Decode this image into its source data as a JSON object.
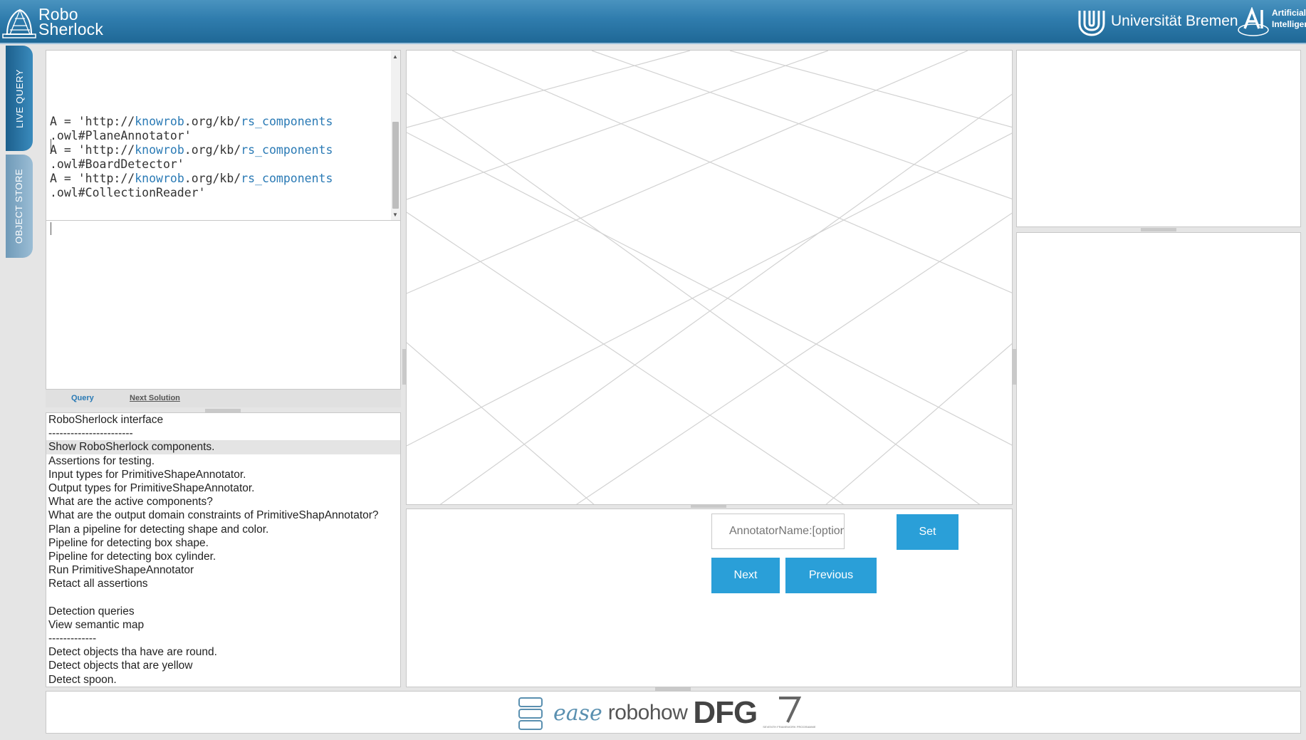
{
  "header": {
    "logo_line1": "Robo",
    "logo_line2": "Sherlock",
    "university": "Universität Bremen",
    "ai_line1": "Artificial",
    "ai_line2": "Intelligen"
  },
  "side_tabs": {
    "live_query": "LIVE QUERY",
    "object_store": "OBJECT STORE"
  },
  "editor": {
    "lines": [
      {
        "prefix": "A = 'http://",
        "host": "knowrob",
        "mid": ".org/kb/",
        "path": "rs_components",
        "rest": ""
      },
      {
        "prefix": "",
        "host": "",
        "mid": "",
        "path": "",
        "rest": ".owl#PlaneAnnotator'"
      },
      {
        "prefix": "A = 'http://",
        "host": "knowrob",
        "mid": ".org/kb/",
        "path": "rs_components",
        "rest": ""
      },
      {
        "prefix": "",
        "host": "",
        "mid": "",
        "path": "",
        "rest": ".owl#BoardDetector'"
      },
      {
        "prefix": "A = 'http://",
        "host": "knowrob",
        "mid": ".org/kb/",
        "path": "rs_components",
        "rest": ""
      },
      {
        "prefix": "",
        "host": "",
        "mid": "",
        "path": "",
        "rest": ".owl#CollectionReader'"
      }
    ]
  },
  "query_bar": {
    "query_label": "Query",
    "next_solution_label": "Next Solution"
  },
  "history": [
    "RoboSherlock interface",
    "-----------------------",
    "Show RoboSherlock components.",
    "Assertions for testing.",
    "Input types for PrimitiveShapeAnnotator.",
    "Output types for PrimitiveShapeAnnotator.",
    "What are the active components?",
    "What are the output domain constraints of PrimitiveShapAnnotator?",
    "Plan a pipeline for detecting shape and color.",
    "Pipeline for detecting box shape.",
    "Pipeline for detecting box cylinder.",
    "Run PrimitiveShapeAnnotator",
    "Retact all assertions",
    "",
    "Detection queries",
    "View semantic map",
    "-------------",
    "Detect objects tha have are round.",
    "Detect objects that are yellow",
    "Detect spoon."
  ],
  "history_selected_index": 2,
  "controls": {
    "annotator_placeholder": "AnnotatorName:[option]",
    "set_label": "Set",
    "next_label": "Next",
    "previous_label": "Previous"
  },
  "footer": {
    "ease_text": "ease",
    "robohow_text": "robohow",
    "dfg_text": "DFG",
    "fp7_caption": "SEVENTH FRAMEWORK PROGRAMME"
  },
  "colors": {
    "header_blue": "#2f7cad",
    "button_blue": "#2a9fd8",
    "link_blue": "#2a7ab5"
  }
}
